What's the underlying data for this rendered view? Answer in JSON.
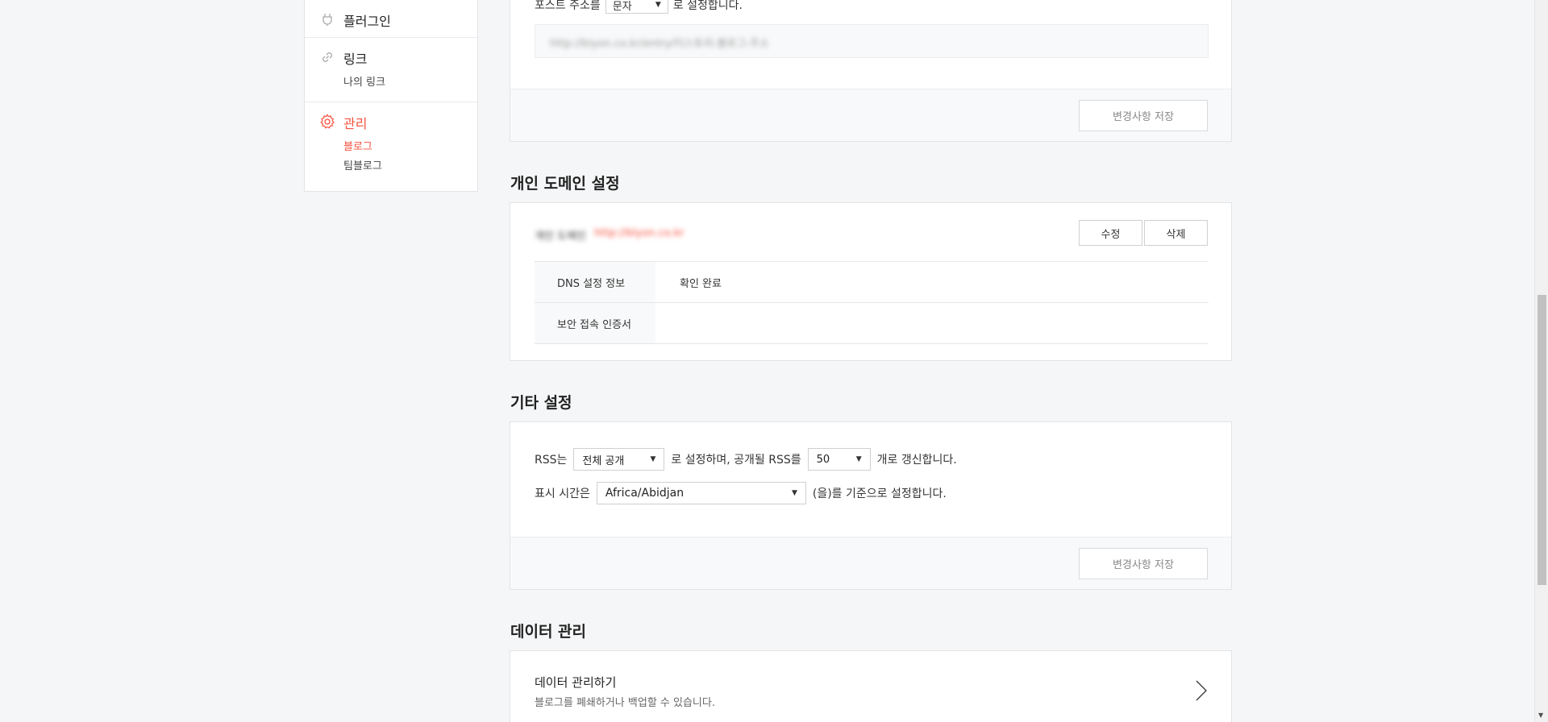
{
  "sidebar": {
    "plugin": {
      "label": "플러그인",
      "icon": "plug-icon"
    },
    "link": {
      "label": "링크",
      "icon": "link-icon",
      "sub": "나의 링크"
    },
    "manage": {
      "label": "관리",
      "icon": "gear-icon",
      "sub_blog": "블로그",
      "sub_teamblog": "팀블로그"
    }
  },
  "post_address": {
    "prefix": "포스트 주소를",
    "select_value": "문자",
    "suffix": "로 설정합니다.",
    "url_preview": "http://blyon.co.kr/entry/티스토리-블로그-주소",
    "save_label": "변경사항 저장"
  },
  "domain": {
    "title": "개인 도메인 설정",
    "label": "개인 도메인",
    "value": "http://blyon.co.kr",
    "edit_label": "수정",
    "delete_label": "삭제",
    "rows": [
      {
        "th": "DNS 설정 정보",
        "td": "확인 완료"
      },
      {
        "th": "보안 접속 인증서",
        "td": ""
      }
    ]
  },
  "other": {
    "title": "기타 설정",
    "rss_prefix": "RSS는",
    "rss_select": "전체 공개",
    "rss_middle": "로 설정하며, 공개될 RSS를",
    "rss_count": "50",
    "rss_suffix": "개로 갱신합니다.",
    "time_prefix": "표시 시간은",
    "timezone": "Africa/Abidjan",
    "time_suffix": "(을)를 기준으로 설정합니다.",
    "save_label": "변경사항 저장"
  },
  "data": {
    "title": "데이터 관리",
    "item_title": "데이터 관리하기",
    "item_desc": "블로그를 폐쇄하거나 백업할 수 있습니다."
  },
  "colors": {
    "accent": "#f5513e",
    "background": "#f5f6f7"
  }
}
